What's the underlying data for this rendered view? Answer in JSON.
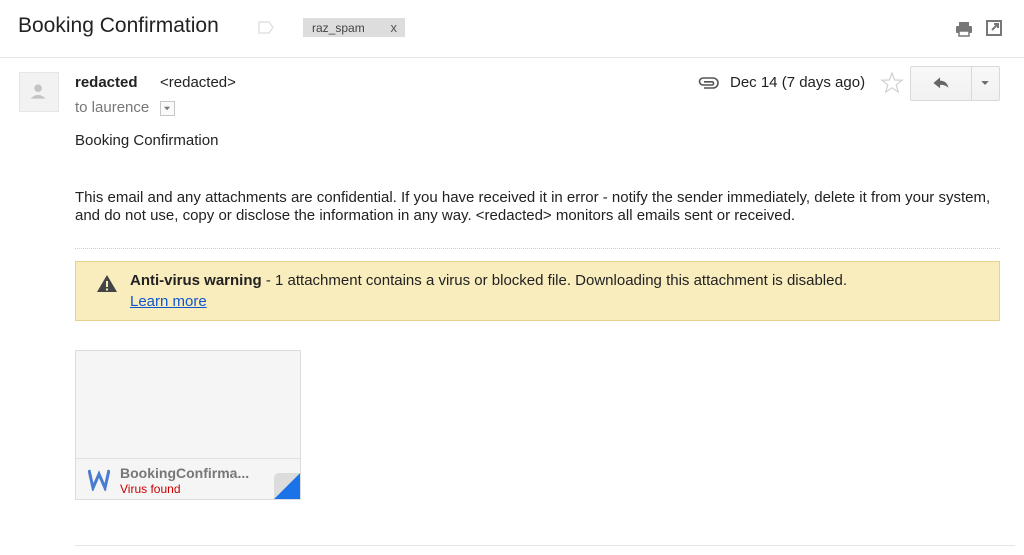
{
  "header": {
    "subject": "Booking Confirmation",
    "label": "raz_spam",
    "label_remove": "x",
    "print_icon": "printer-icon",
    "popout_icon": "new-window-icon"
  },
  "message": {
    "sender_name": "redacted",
    "sender_email": "<redacted>",
    "to": "to laurence",
    "date": "Dec 14 (7 days ago)",
    "icons": {
      "attachment": "paperclip-icon",
      "star": "star-icon",
      "reply": "reply-icon",
      "more": "chevron-down-icon"
    }
  },
  "body": {
    "title": "Booking Confirmation",
    "disclaimer": "This email and any attachments are confidential. If you have received it in error - notify the sender immediately, delete it from your system, and do not use, copy or disclose the information in any way. <redacted> monitors all emails sent or received."
  },
  "warning": {
    "title": "Anti-virus warning",
    "text": " - 1 attachment contains a virus or blocked file. Downloading this attachment is disabled.",
    "link": "Learn more",
    "background": "#f9edbe"
  },
  "attachment": {
    "name": "BookingConfirma...",
    "status": "Virus found",
    "status_color": "#cc0000",
    "icon": "word-doc-icon",
    "icon_color": "#4a7ccf"
  }
}
